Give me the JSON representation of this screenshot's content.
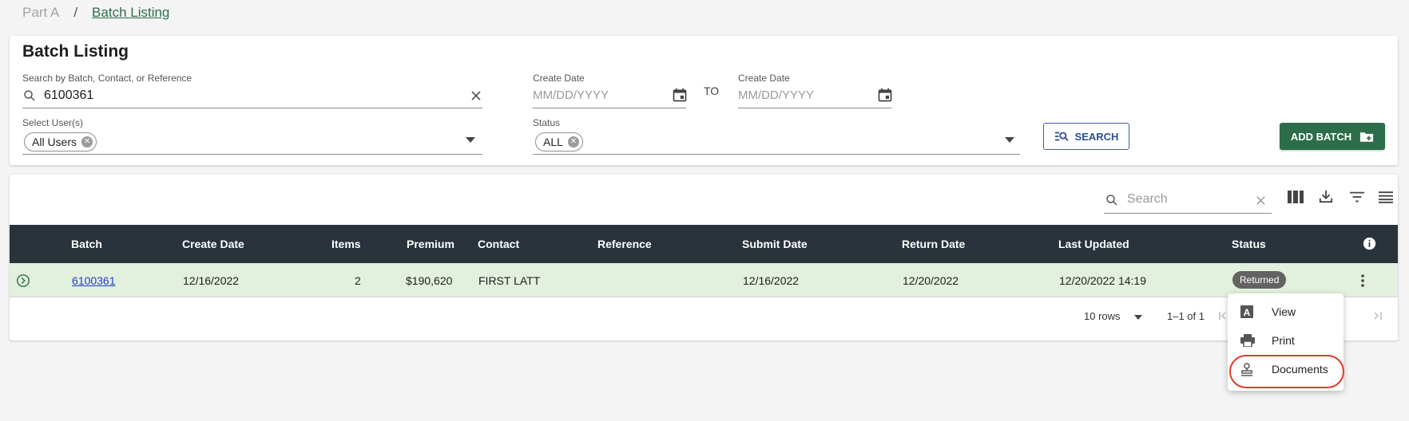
{
  "breadcrumb": {
    "parent": "Part A",
    "separator": "/",
    "current": "Batch Listing"
  },
  "filters": {
    "title": "Batch Listing",
    "search_label": "Search by Batch, Contact, or Reference",
    "search_value": "6100361",
    "create_date_from_label": "Create Date",
    "create_date_from_placeholder": "MM/DD/YYYY",
    "to_label": "TO",
    "create_date_to_label": "Create Date",
    "create_date_to_placeholder": "MM/DD/YYYY",
    "users_label": "Select User(s)",
    "users_chip": "All Users",
    "status_label": "Status",
    "status_chip": "ALL",
    "search_button": "SEARCH",
    "add_batch_button": "ADD BATCH"
  },
  "table_toolbar": {
    "search_placeholder": "Search"
  },
  "table": {
    "columns": [
      "Batch",
      "Create Date",
      "Items",
      "Premium",
      "Contact",
      "Reference",
      "Submit Date",
      "Return Date",
      "Last Updated",
      "Status"
    ],
    "rows": [
      {
        "batch": "6100361",
        "create_date": "12/16/2022",
        "items": "2",
        "premium": "$190,620",
        "contact": "FIRST LATT",
        "reference": "",
        "submit_date": "12/16/2022",
        "return_date": "12/20/2022",
        "last_updated": "12/20/2022 14:19",
        "status": "Returned"
      }
    ]
  },
  "pagination": {
    "rows_per_page": "10 rows",
    "range": "1–1 of 1"
  },
  "context_menu": {
    "items": [
      {
        "label": "View",
        "icon": "view-icon"
      },
      {
        "label": "Print",
        "icon": "print-icon"
      },
      {
        "label": "Documents",
        "icon": "stamp-icon"
      }
    ]
  },
  "colors": {
    "brand_green": "#2c6e49",
    "header_dark": "#2a333c",
    "row_highlight": "#e3f0dd",
    "link_blue": "#1a3fd1",
    "annotation_red": "#e03a2a"
  }
}
